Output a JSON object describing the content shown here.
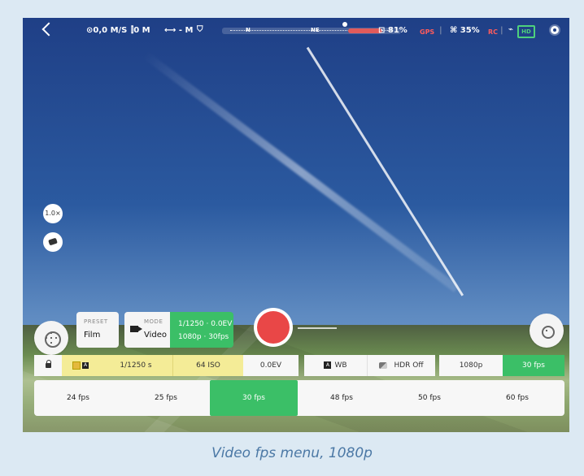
{
  "topbar": {
    "speed": "⊙0,0 M/S",
    "altitude": "⫿0 M",
    "distance": "⟷ - M",
    "compass_left": "N",
    "compass_right": "NE",
    "battery_drone": "⊡ 81%",
    "battery_tablet": "⌘ 35%",
    "sats_label": "GPS",
    "rc_label": "RC",
    "hd_label": "HD"
  },
  "side_controls": {
    "zoom": "1.0×"
  },
  "bottom_controls": {
    "preset_small": "PRESET",
    "preset_value": "Film",
    "mode_small": "MODE",
    "mode_value": "Video",
    "mode_info_line1": "1/1250 · 0.0EV",
    "mode_info_line2": "1080p · 30fps"
  },
  "param_row": {
    "shutter": "1/1250 s",
    "iso": "64 ISO",
    "ev": "0.0EV",
    "wb": "WB",
    "hdr": "HDR Off",
    "resolution": "1080p",
    "fps": "30 fps"
  },
  "fps_menu": {
    "items": [
      "24 fps",
      "25 fps",
      "30 fps",
      "48 fps",
      "50 fps",
      "60 fps"
    ],
    "active_index": 2
  },
  "caption": "Video fps menu, 1080p",
  "colors": {
    "accent_green": "#3bbf67",
    "record_red": "#e94747",
    "highlight_yellow": "#f4ec97"
  }
}
